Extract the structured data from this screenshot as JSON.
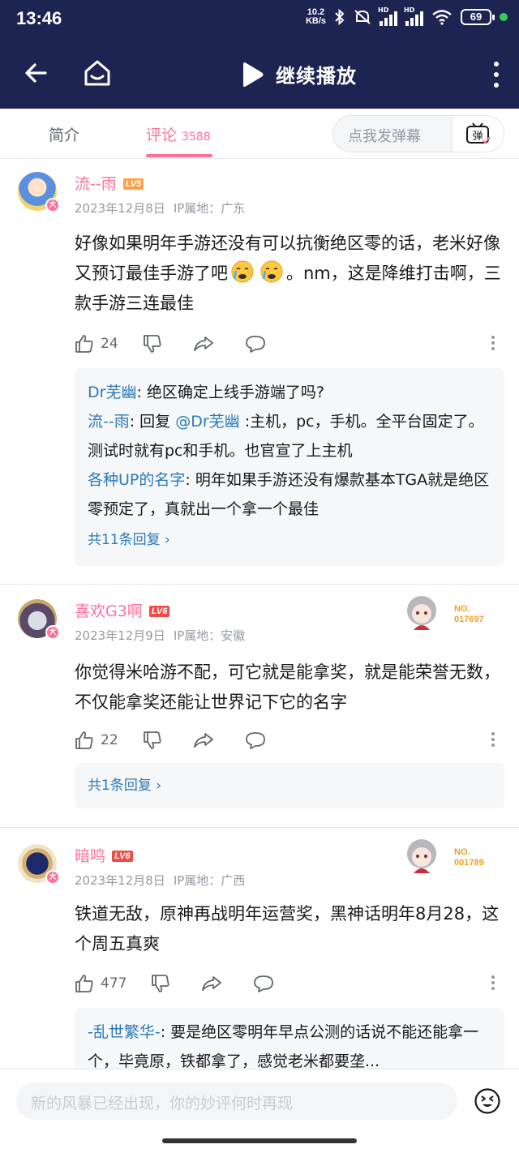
{
  "status": {
    "time": "13:46",
    "net_speed": "10.2",
    "net_unit": "KB/s",
    "sig1": "HD",
    "sig2": "HD",
    "battery": "69"
  },
  "topnav": {
    "play_label": "继续播放"
  },
  "tabs": {
    "intro": "简介",
    "comments": "评论",
    "comment_count": "3588",
    "danmu_placeholder": "点我发弹幕",
    "danmu_btn": "弹"
  },
  "comments": [
    {
      "user": "流--雨",
      "level": "LV5",
      "date": "2023年12月8日",
      "ip": "IP属地：广东",
      "text_a": "好像如果明年手游还没有可以抗衡绝区零的话，老米好像又预订最佳手游了吧",
      "text_b": "。nm，这是降维打击啊，三款手游三连最佳",
      "likes": "24",
      "replies": [
        {
          "name": "Dr芜幽",
          "text": ": 绝区确定上线手游端了吗?"
        },
        {
          "name": "流--雨",
          "text_pre": ": 回复 ",
          "mention": "@Dr芜幽",
          "text": " :主机，pc，手机。全平台固定了。测试时就有pc和手机。也官宣了上主机"
        },
        {
          "name": "各种UP的名字",
          "text": ": 明年如果手游还没有爆款基本TGA就是绝区零预定了，真就出一个拿一个最佳"
        }
      ],
      "more_replies": "共11条回复 ›"
    },
    {
      "user": "喜欢G3啊",
      "level": "LV6",
      "date": "2023年12月9日",
      "ip": "IP属地：安徽",
      "text": "你觉得米哈游不配，可它就是能拿奖，就是能荣誉无数，不仅能拿奖还能让世界记下它的名字",
      "likes": "22",
      "fan_no_label": "NO.",
      "fan_no": "017697",
      "more_replies": "共1条回复 ›"
    },
    {
      "user": "暗鸣",
      "level": "LV6",
      "date": "2023年12月8日",
      "ip": "IP属地：广西",
      "text": "铁道无敌，原神再战明年运营奖，黑神话明年8月28，这个周五真爽",
      "likes": "477",
      "fan_no_label": "NO.",
      "fan_no": "001789",
      "replies": [
        {
          "name": "-乱世繁华-",
          "text": ": 要是绝区零明年早点公测的话说不能还能拿一个，毕竟原，铁都拿了，感觉老米都要垄..."
        }
      ]
    }
  ],
  "avatar_badge": "大",
  "bottom": {
    "placeholder": "新的风暴已经出现，你的妙评何时再现"
  },
  "colors": {
    "nav_bg": "#1e2452",
    "accent": "#fb7299",
    "link": "#2b79b9"
  }
}
